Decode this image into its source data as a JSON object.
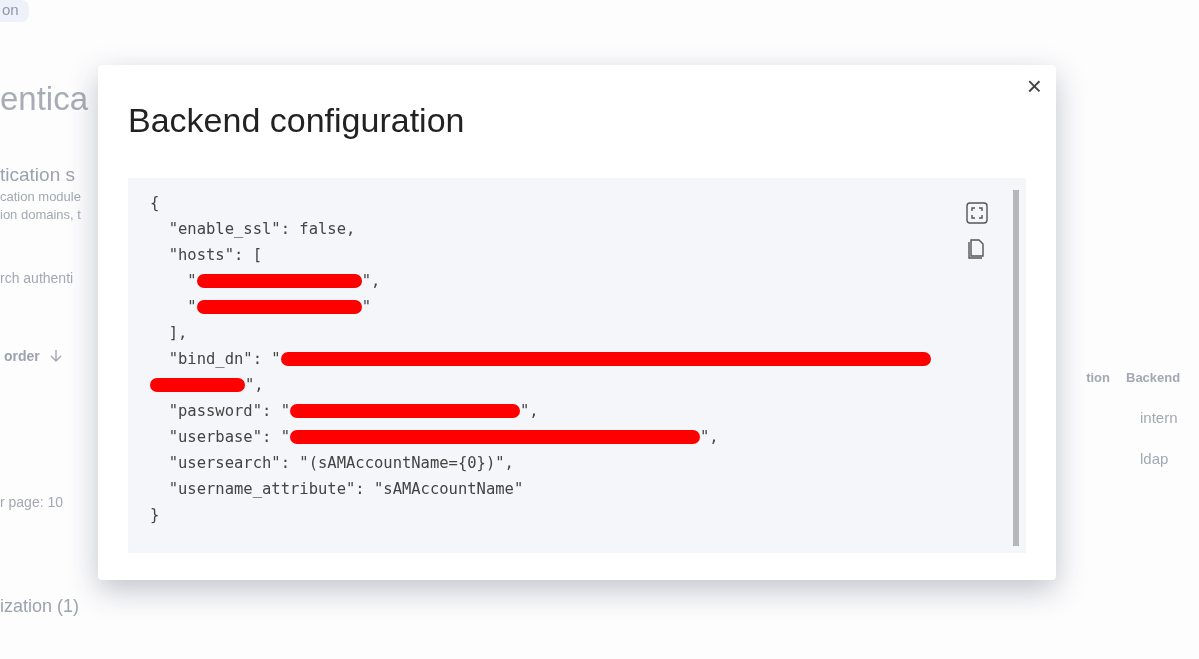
{
  "background": {
    "badge": "on",
    "heading": "entica",
    "section_title": "tication s",
    "description_lines": [
      "cation module",
      "ion domains, t"
    ],
    "search_placeholder": "rch authenti",
    "sort_column": "order",
    "rows_per_page": "r page: 10",
    "section_title_2": "ization (1)",
    "right_columns": [
      "tion",
      "Backend"
    ],
    "right_cells": [
      "intern",
      "ldap"
    ]
  },
  "modal": {
    "title": "Backend configuration",
    "code_lines": [
      [
        {
          "kind": "text",
          "text": "{"
        }
      ],
      [
        {
          "kind": "text",
          "text": "  \"enable_ssl\": false,"
        }
      ],
      [
        {
          "kind": "text",
          "text": "  \"hosts\": ["
        }
      ],
      [
        {
          "kind": "text",
          "text": "    \""
        },
        {
          "kind": "redaction"
        },
        {
          "kind": "text",
          "text": "\","
        }
      ],
      [
        {
          "kind": "text",
          "text": "    \""
        },
        {
          "kind": "redaction"
        },
        {
          "kind": "text",
          "text": "\""
        }
      ],
      [
        {
          "kind": "text",
          "text": "  ],"
        }
      ],
      [
        {
          "kind": "text",
          "text": "  \"bind_dn\": \""
        },
        {
          "kind": "redaction"
        }
      ],
      [
        {
          "kind": "redaction"
        },
        {
          "kind": "text",
          "text": "\","
        }
      ],
      [
        {
          "kind": "text",
          "text": "  \"password\": \""
        },
        {
          "kind": "redaction"
        },
        {
          "kind": "text",
          "text": "\","
        }
      ],
      [
        {
          "kind": "text",
          "text": "  \"userbase\": \""
        },
        {
          "kind": "redaction"
        },
        {
          "kind": "text",
          "text": "\","
        }
      ],
      [
        {
          "kind": "text",
          "text": "  \"usersearch\": \"(sAMAccountName={0})\","
        }
      ],
      [
        {
          "kind": "text",
          "text": "  \"username_attribute\": \"sAMAccountName\""
        }
      ],
      [
        {
          "kind": "text",
          "text": "}"
        }
      ]
    ],
    "close": "×"
  }
}
